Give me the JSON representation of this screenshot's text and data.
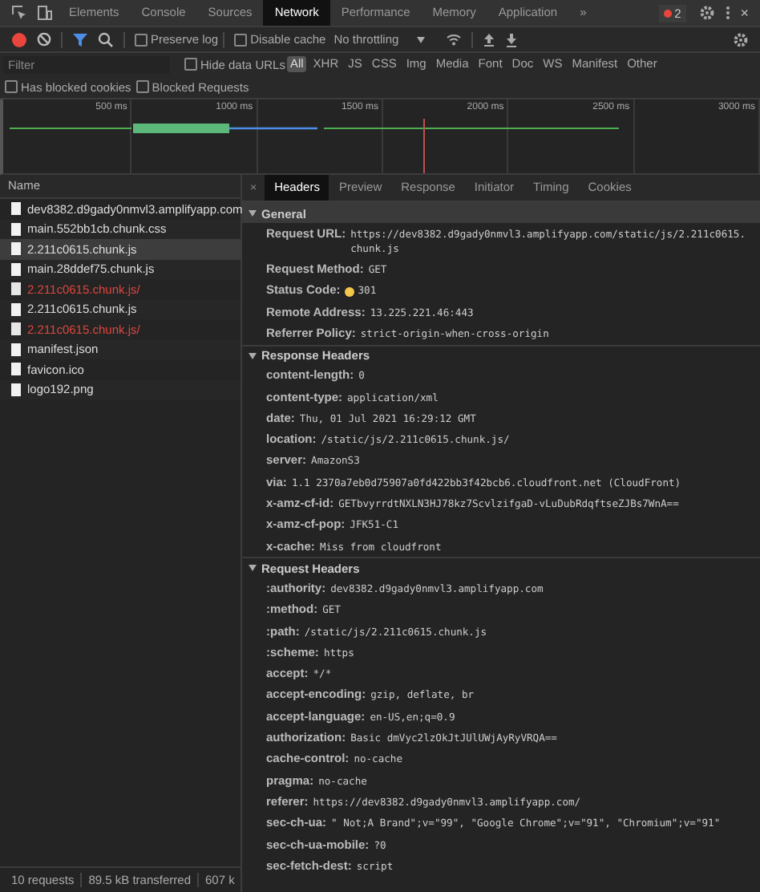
{
  "devtools_tabs": [
    {
      "label": "Elements",
      "selected": false
    },
    {
      "label": "Console",
      "selected": false
    },
    {
      "label": "Sources",
      "selected": false
    },
    {
      "label": "Network",
      "selected": true
    },
    {
      "label": "Performance",
      "selected": false
    },
    {
      "label": "Memory",
      "selected": false
    },
    {
      "label": "Application",
      "selected": false
    }
  ],
  "more_tabs": "»",
  "error_count": "2",
  "close": "×",
  "toolbar": {
    "recording": true,
    "preserve_log": {
      "label": "Preserve log",
      "checked": false
    },
    "disable_cache": {
      "label": "Disable cache",
      "checked": false
    },
    "throttling": "No throttling"
  },
  "filter": {
    "placeholder": "Filter",
    "hide_data_urls": {
      "label": "Hide data URLs",
      "checked": false
    },
    "types": [
      {
        "label": "All",
        "selected": true
      },
      {
        "label": "XHR",
        "selected": false
      },
      {
        "label": "JS",
        "selected": false
      },
      {
        "label": "CSS",
        "selected": false
      },
      {
        "label": "Img",
        "selected": false
      },
      {
        "label": "Media",
        "selected": false
      },
      {
        "label": "Font",
        "selected": false
      },
      {
        "label": "Doc",
        "selected": false
      },
      {
        "label": "WS",
        "selected": false
      },
      {
        "label": "Manifest",
        "selected": false
      },
      {
        "label": "Other",
        "selected": false
      }
    ],
    "has_blocked_cookies": {
      "label": "Has blocked cookies",
      "checked": false
    },
    "blocked_requests": {
      "label": "Blocked Requests",
      "checked": false
    }
  },
  "timeline_ticks": [
    "500 ms",
    "1000 ms",
    "1500 ms",
    "2000 ms",
    "2500 ms",
    "3000 ms"
  ],
  "requests_header": "Name",
  "requests": [
    {
      "name": "dev8382.d9gady0nmvl3.amplifyapp.com",
      "error": false,
      "selected": false
    },
    {
      "name": "main.552bb1cb.chunk.css",
      "error": false,
      "selected": false
    },
    {
      "name": "2.211c0615.chunk.js",
      "error": false,
      "selected": true
    },
    {
      "name": "main.28ddef75.chunk.js",
      "error": false,
      "selected": false
    },
    {
      "name": "2.211c0615.chunk.js/",
      "error": true,
      "selected": false
    },
    {
      "name": "2.211c0615.chunk.js",
      "error": false,
      "selected": false
    },
    {
      "name": "2.211c0615.chunk.js/",
      "error": true,
      "selected": false
    },
    {
      "name": "manifest.json",
      "error": false,
      "selected": false
    },
    {
      "name": "favicon.ico",
      "error": false,
      "selected": false
    },
    {
      "name": "logo192.png",
      "error": false,
      "selected": false
    }
  ],
  "detail_close": "×",
  "detail_tabs": [
    {
      "label": "Headers",
      "selected": true
    },
    {
      "label": "Preview",
      "selected": false
    },
    {
      "label": "Response",
      "selected": false
    },
    {
      "label": "Initiator",
      "selected": false
    },
    {
      "label": "Timing",
      "selected": false
    },
    {
      "label": "Cookies",
      "selected": false
    }
  ],
  "sections": [
    {
      "title": "General",
      "expanded": true,
      "entries": [
        {
          "key": "Request URL:",
          "value": "https://dev8382.d9gady0nmvl3.amplifyapp.com/static/js/2.211c0615.chunk.js"
        },
        {
          "key": "Request Method:",
          "value": "GET"
        },
        {
          "key": "Status Code:",
          "value": "301",
          "color": "#f2c84b"
        },
        {
          "key": "Remote Address:",
          "value": "13.225.221.46:443"
        },
        {
          "key": "Referrer Policy:",
          "value": "strict-origin-when-cross-origin"
        }
      ]
    },
    {
      "title": "Response Headers",
      "expanded": true,
      "entries": [
        {
          "key": "content-length:",
          "value": "0"
        },
        {
          "key": "content-type:",
          "value": "application/xml"
        },
        {
          "key": "date:",
          "value": "Thu, 01 Jul 2021 16:29:12 GMT"
        },
        {
          "key": "location:",
          "value": "/static/js/2.211c0615.chunk.js/"
        },
        {
          "key": "server:",
          "value": "AmazonS3"
        },
        {
          "key": "via:",
          "value": "1.1 2370a7eb0d75907a0fd422bb3f42bcb6.cloudfront.net (CloudFront)"
        },
        {
          "key": "x-amz-cf-id:",
          "value": "GETbvyrrdtNXLN3HJ78kz7ScvlzifgaD-vLuDubRdqftseZJBs7WnA=="
        },
        {
          "key": "x-amz-cf-pop:",
          "value": "JFK51-C1"
        },
        {
          "key": "x-cache:",
          "value": "Miss from cloudfront"
        }
      ]
    },
    {
      "title": "Request Headers",
      "expanded": true,
      "entries": [
        {
          "key": ":authority:",
          "value": "dev8382.d9gady0nmvl3.amplifyapp.com"
        },
        {
          "key": ":method:",
          "value": "GET"
        },
        {
          "key": ":path:",
          "value": "/static/js/2.211c0615.chunk.js"
        },
        {
          "key": ":scheme:",
          "value": "https"
        },
        {
          "key": "accept:",
          "value": "*/*"
        },
        {
          "key": "accept-encoding:",
          "value": "gzip, deflate, br"
        },
        {
          "key": "accept-language:",
          "value": "en-US,en;q=0.9"
        },
        {
          "key": "authorization:",
          "value": "Basic dmVyc2lzOkJtJUlUWjAyRyVRQA=="
        },
        {
          "key": "cache-control:",
          "value": "no-cache"
        },
        {
          "key": "pragma:",
          "value": "no-cache"
        },
        {
          "key": "referer:",
          "value": "https://dev8382.d9gady0nmvl3.amplifyapp.com/"
        },
        {
          "key": "sec-ch-ua:",
          "value": "\" Not;A Brand\";v=\"99\", \"Google Chrome\";v=\"91\", \"Chromium\";v=\"91\""
        },
        {
          "key": "sec-ch-ua-mobile:",
          "value": "?0"
        },
        {
          "key": "sec-fetch-dest:",
          "value": "script"
        }
      ]
    }
  ],
  "status_bar": [
    "10 requests",
    "89.5 kB transferred",
    "607 k"
  ]
}
